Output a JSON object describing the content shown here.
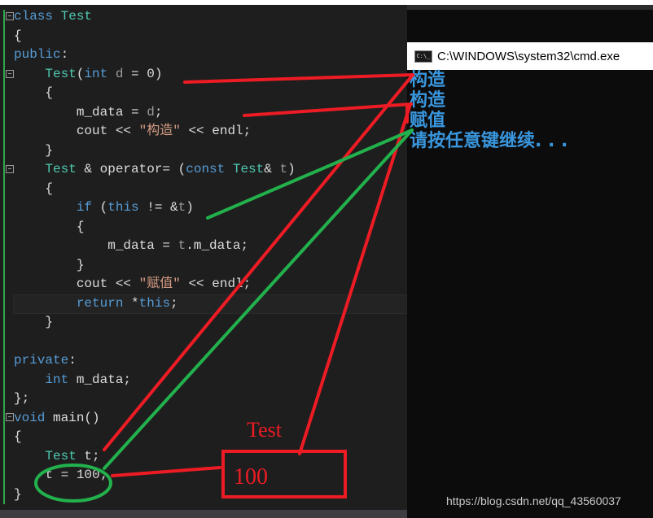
{
  "editor": {
    "code_lines": [
      {
        "id": "l1",
        "segments": [
          {
            "t": "class ",
            "c": "kw"
          },
          {
            "t": "Test",
            "c": "ty"
          }
        ]
      },
      {
        "id": "l2",
        "segments": [
          {
            "t": "{",
            "c": ""
          }
        ]
      },
      {
        "id": "l3",
        "segments": [
          {
            "t": "public",
            "c": "kw"
          },
          {
            "t": ":",
            "c": ""
          }
        ]
      },
      {
        "id": "l4",
        "segments": [
          {
            "t": "    Test",
            "c": "ty"
          },
          {
            "t": "(",
            "c": ""
          },
          {
            "t": "int",
            "c": "kw"
          },
          {
            "t": " d ",
            "c": "par"
          },
          {
            "t": "= 0)",
            "c": ""
          }
        ]
      },
      {
        "id": "l5",
        "segments": [
          {
            "t": "    {",
            "c": ""
          }
        ]
      },
      {
        "id": "l6",
        "segments": [
          {
            "t": "        m_data = ",
            "c": ""
          },
          {
            "t": "d",
            "c": "par"
          },
          {
            "t": ";",
            "c": ""
          }
        ]
      },
      {
        "id": "l7",
        "segments": [
          {
            "t": "        cout << ",
            "c": ""
          },
          {
            "t": "\"构造\"",
            "c": "str"
          },
          {
            "t": " << endl;",
            "c": ""
          }
        ]
      },
      {
        "id": "l8",
        "segments": [
          {
            "t": "    }",
            "c": ""
          }
        ]
      },
      {
        "id": "l9",
        "segments": [
          {
            "t": "    Test",
            "c": "ty"
          },
          {
            "t": " & operator= (",
            "c": ""
          },
          {
            "t": "const ",
            "c": "kw"
          },
          {
            "t": "Test",
            "c": "ty"
          },
          {
            "t": "& ",
            "c": ""
          },
          {
            "t": "t",
            "c": "par"
          },
          {
            "t": ")",
            "c": ""
          }
        ]
      },
      {
        "id": "l10",
        "segments": [
          {
            "t": "    {",
            "c": ""
          }
        ]
      },
      {
        "id": "l11",
        "segments": [
          {
            "t": "        if ",
            "c": "kw"
          },
          {
            "t": "(",
            "c": ""
          },
          {
            "t": "this",
            "c": "kw"
          },
          {
            "t": " != &",
            "c": ""
          },
          {
            "t": "t",
            "c": "par"
          },
          {
            "t": ")",
            "c": ""
          }
        ]
      },
      {
        "id": "l12",
        "segments": [
          {
            "t": "        {",
            "c": ""
          }
        ]
      },
      {
        "id": "l13",
        "segments": [
          {
            "t": "            m_data = ",
            "c": ""
          },
          {
            "t": "t",
            "c": "par"
          },
          {
            "t": ".m_data;",
            "c": ""
          }
        ]
      },
      {
        "id": "l14",
        "segments": [
          {
            "t": "        }",
            "c": ""
          }
        ]
      },
      {
        "id": "l15",
        "segments": [
          {
            "t": "        cout << ",
            "c": ""
          },
          {
            "t": "\"赋值\"",
            "c": "str"
          },
          {
            "t": " << endl;",
            "c": ""
          }
        ]
      },
      {
        "id": "l16",
        "segments": [
          {
            "t": "        return ",
            "c": "kw"
          },
          {
            "t": "*",
            "c": ""
          },
          {
            "t": "this",
            "c": "kw"
          },
          {
            "t": ";",
            "c": ""
          }
        ]
      },
      {
        "id": "l17",
        "segments": [
          {
            "t": "    }",
            "c": ""
          }
        ]
      },
      {
        "id": "l18",
        "segments": [
          {
            "t": "",
            "c": ""
          }
        ]
      },
      {
        "id": "l19",
        "segments": [
          {
            "t": "private",
            "c": "kw"
          },
          {
            "t": ":",
            "c": ""
          }
        ]
      },
      {
        "id": "l20",
        "segments": [
          {
            "t": "    int ",
            "c": "kw"
          },
          {
            "t": "m_data;",
            "c": ""
          }
        ]
      },
      {
        "id": "l21",
        "segments": [
          {
            "t": "};",
            "c": ""
          }
        ]
      },
      {
        "id": "l22",
        "segments": [
          {
            "t": "void ",
            "c": "kw"
          },
          {
            "t": "main()",
            "c": ""
          }
        ]
      },
      {
        "id": "l23",
        "segments": [
          {
            "t": "{",
            "c": ""
          }
        ]
      },
      {
        "id": "l24",
        "segments": [
          {
            "t": "    Test",
            "c": "ty"
          },
          {
            "t": " t;",
            "c": ""
          }
        ]
      },
      {
        "id": "l25",
        "segments": [
          {
            "t": "    t = 100;",
            "c": ""
          }
        ]
      },
      {
        "id": "l26",
        "segments": [
          {
            "t": "}",
            "c": ""
          }
        ]
      }
    ]
  },
  "console": {
    "title": "C:\\WINDOWS\\system32\\cmd.exe",
    "icon_label": "C:\\_",
    "output_lines": [
      "构造",
      "构造",
      "赋值",
      "请按任意键继续. . ."
    ]
  },
  "annotations": {
    "label_test": "Test",
    "label_100": "100",
    "colors": {
      "red": "#ed1c24",
      "green": "#22b14c"
    }
  },
  "watermark": "https://blog.csdn.net/qq_43560037"
}
